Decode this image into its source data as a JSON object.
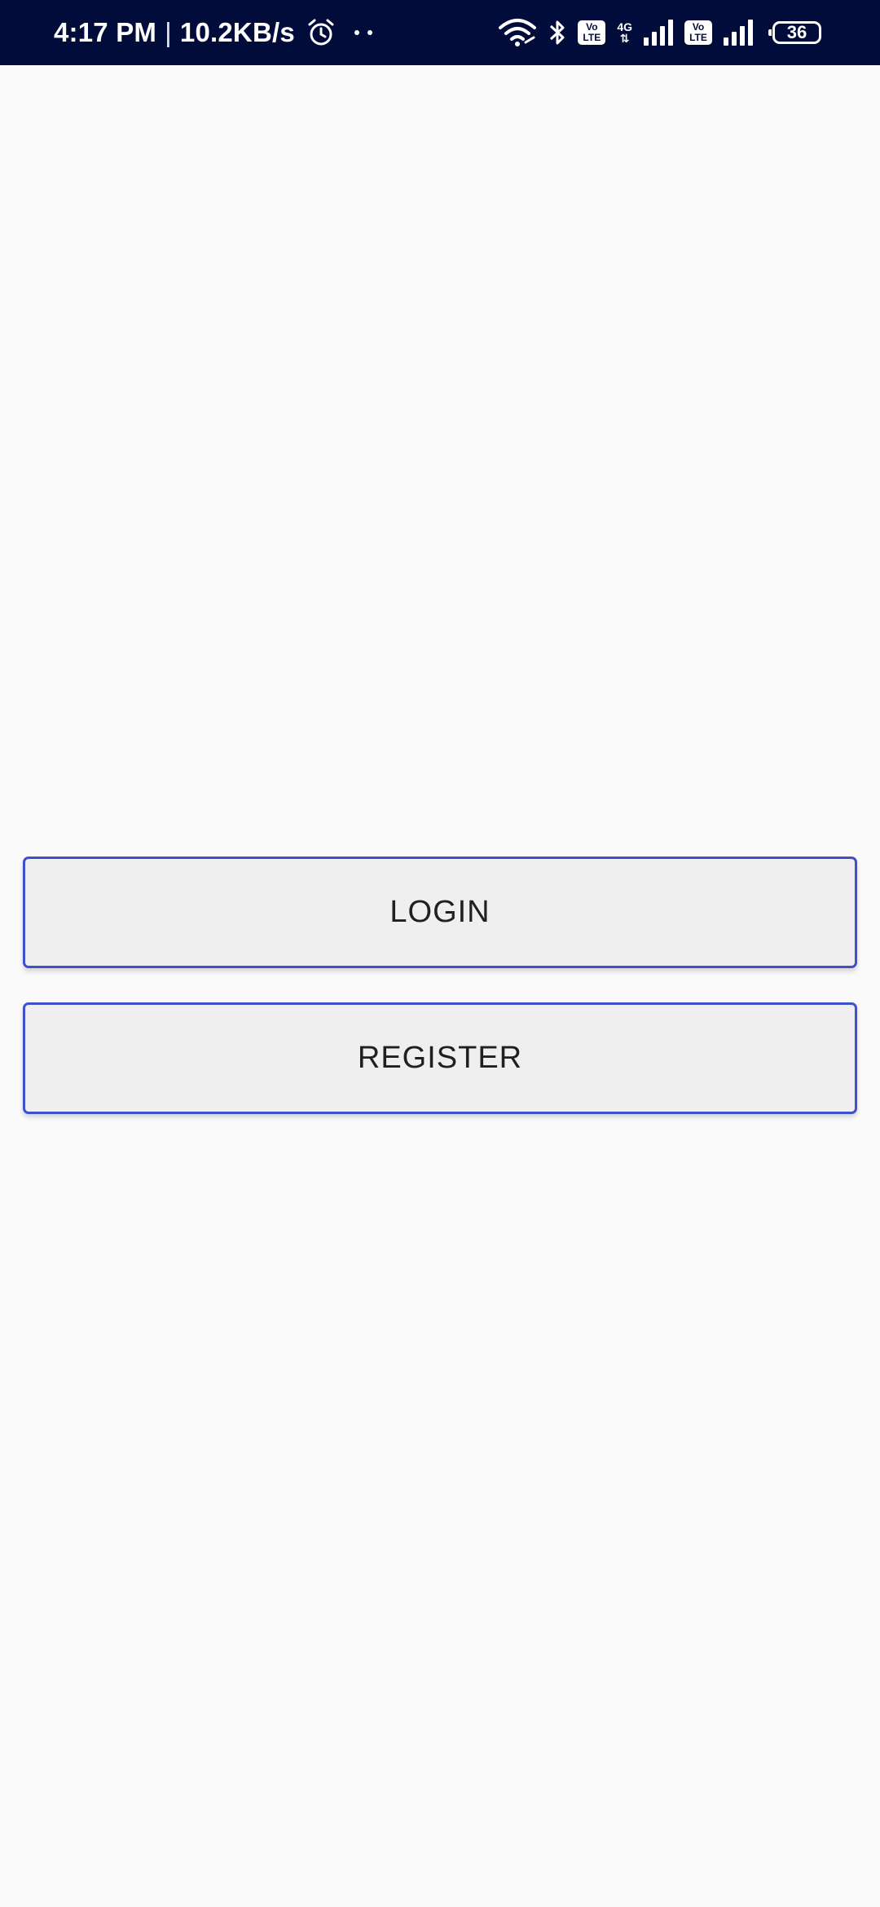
{
  "status_bar": {
    "time": "4:17 PM",
    "separator": "|",
    "network_speed": "10.2KB/s",
    "icons": [
      "alarm-icon",
      "dots-icon",
      "wifi-icon",
      "bluetooth-icon",
      "volte-icon",
      "signal-icon",
      "volte-icon",
      "signal-icon",
      "battery-icon"
    ],
    "volte_label": "Vo LTE",
    "network_type": "4G",
    "battery_level": "36",
    "background_color": "#020c3a"
  },
  "main": {
    "login_label": "LOGIN",
    "register_label": "REGISTER",
    "button_border_color": "#3f51c8",
    "button_background": "#efefef",
    "page_background": "#fafafa"
  }
}
